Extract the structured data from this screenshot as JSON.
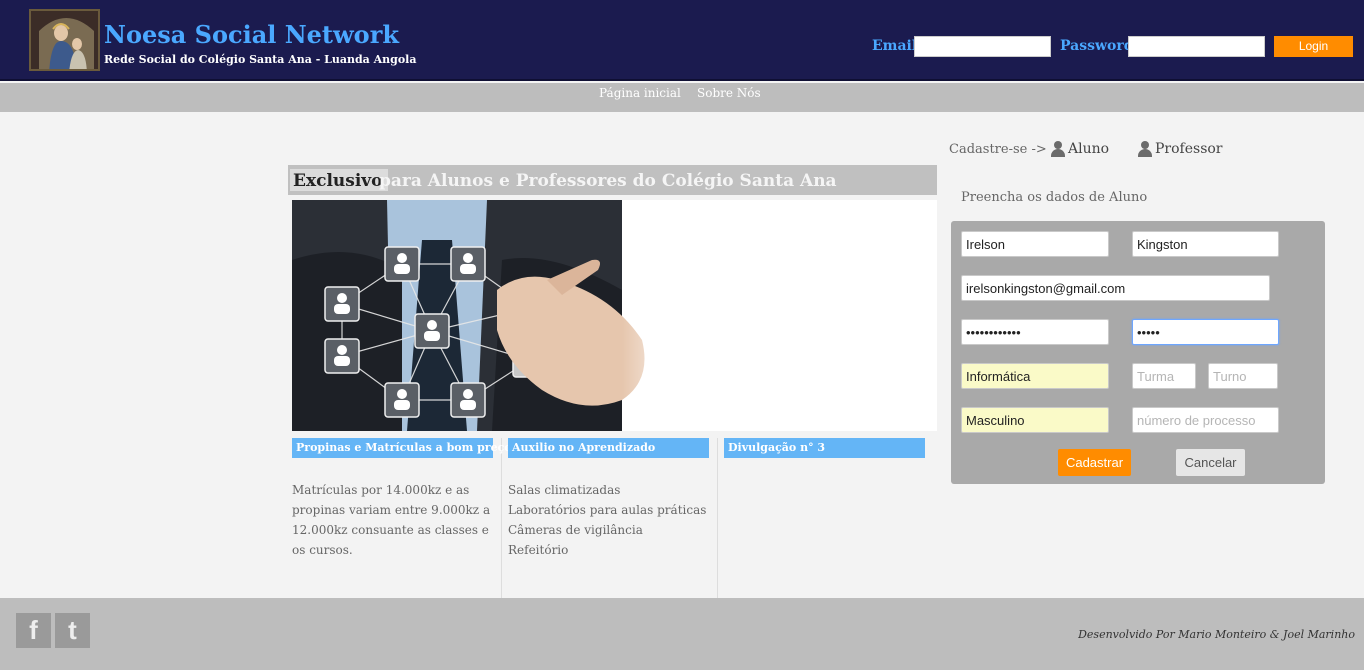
{
  "header": {
    "title": "Noesa Social Network",
    "subtitle": "Rede Social do Colégio Santa Ana - Luanda Angola",
    "email_label": "Email",
    "password_label": "Password",
    "login_label": "Login"
  },
  "nav": {
    "items": [
      {
        "label": "Página inicial"
      },
      {
        "label": "Sobre Nós"
      }
    ]
  },
  "banner": {
    "strong": "Exclusivo",
    "rest": "para Alunos e Professores do Colégio Santa Ana"
  },
  "columns": [
    {
      "heading": "Propinas e Matrículas a bom preço",
      "body": "Matrículas por 14.000kz e as propinas variam entre 9.000kz a 12.000kz consuante as classes e os cursos."
    },
    {
      "heading": "Auxilio no Aprendizado",
      "lines": [
        "Salas climatizadas",
        "Laboratórios para aulas práticas",
        "Câmeras de vigilância",
        "Refeitório"
      ]
    },
    {
      "heading": "Divulgação n° 3"
    }
  ],
  "register": {
    "label": "Cadastre-se ->",
    "aluno": "Aluno",
    "professor": "Professor",
    "form_title": "Preencha os dados de Aluno"
  },
  "form": {
    "first_name": "Irelson",
    "last_name": "Kingston",
    "email": "irelsonkingston@gmail.com",
    "password": "••••••••••••",
    "password_confirm": "•••••",
    "course": "Informática",
    "turma_placeholder": "Turma",
    "turno_placeholder": "Turno",
    "gender": "Masculino",
    "processo_placeholder": "número de processo",
    "submit_label": "Cadastrar",
    "cancel_label": "Cancelar"
  },
  "footer": {
    "facebook": "f",
    "twitter": "t",
    "credits": "Desenvolvido Por Mario Monteiro & Joel Marinho"
  },
  "colors": {
    "header_bg": "#1b1b4f",
    "title_blue": "#4aa8ff",
    "accent_orange": "#ff8c00",
    "column_head_blue": "#64b5f6"
  },
  "icons": [
    "user-icon",
    "facebook-icon",
    "twitter-icon"
  ]
}
